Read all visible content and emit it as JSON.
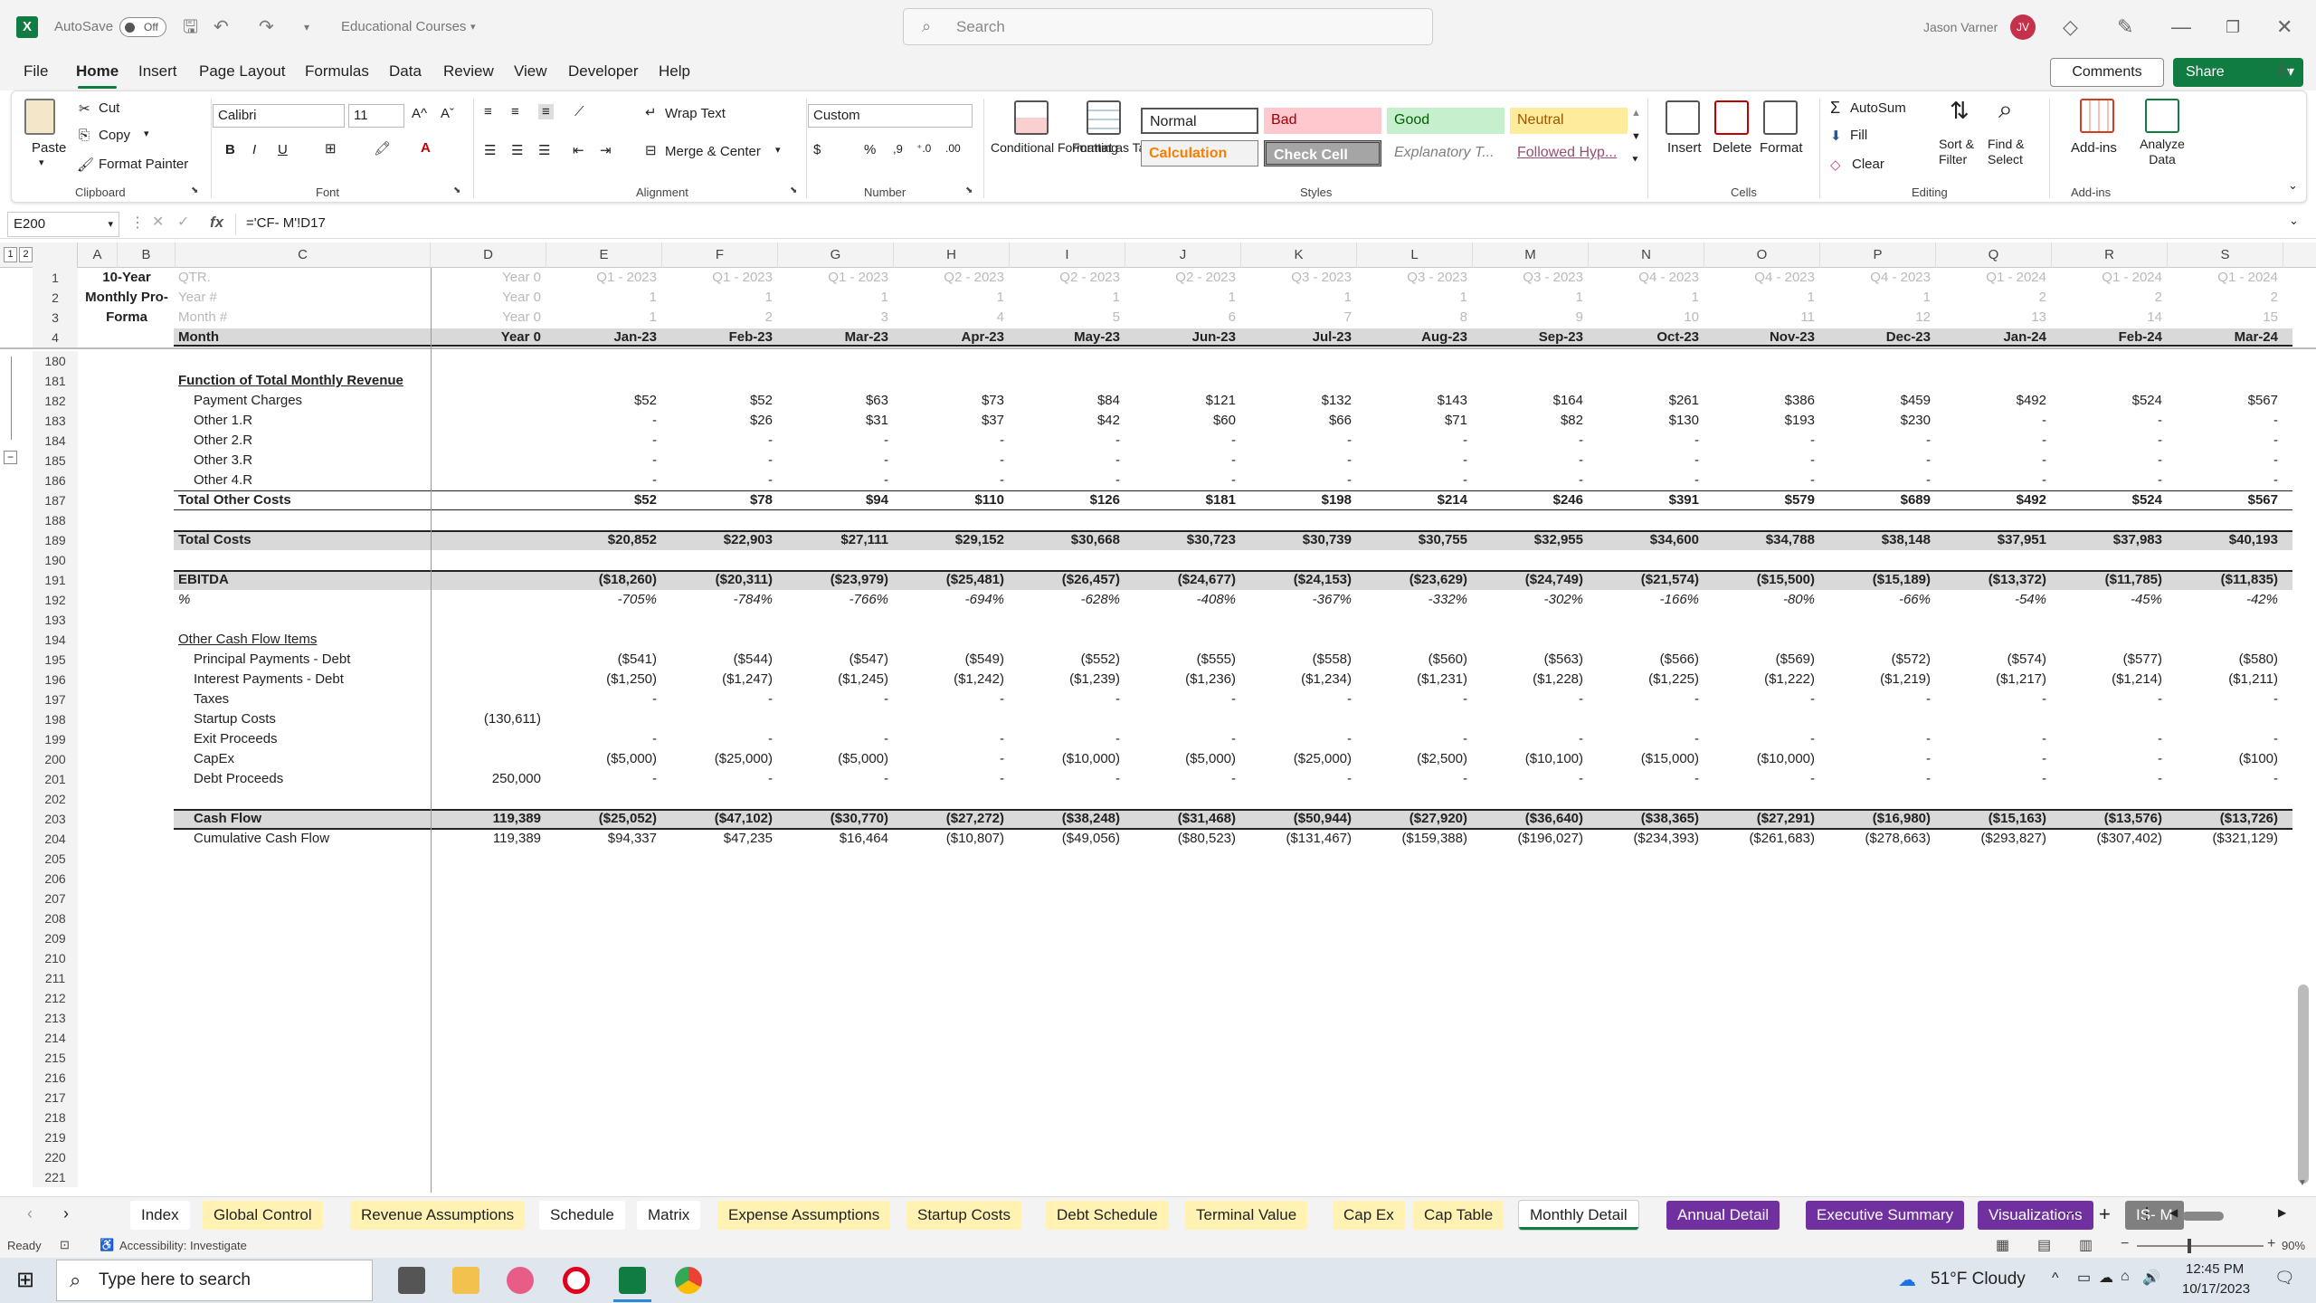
{
  "titlebar": {
    "autosave": "AutoSave",
    "toggle": "Off",
    "doc": "Educational Courses",
    "search_placeholder": "Search",
    "user": "Jason Varner",
    "initials": "JV"
  },
  "menu": [
    "File",
    "Home",
    "Insert",
    "Page Layout",
    "Formulas",
    "Data",
    "Review",
    "View",
    "Developer",
    "Help"
  ],
  "menu_active": "Home",
  "comments": "Comments",
  "share": "Share",
  "ribbon": {
    "paste": "Paste",
    "cut": "Cut",
    "copy": "Copy",
    "format_painter": "Format Painter",
    "clipboard": "Clipboard",
    "font_name": "Calibri",
    "font_size": "11",
    "font": "Font",
    "wrap_text": "Wrap Text",
    "merge_center": "Merge & Center",
    "alignment": "Alignment",
    "number_format": "Custom",
    "number": "Number",
    "conditional_formatting": "Conditional Formatting",
    "format_as_table": "Format as Table",
    "styles": {
      "normal": "Normal",
      "bad": "Bad",
      "good": "Good",
      "neutral": "Neutral",
      "calculation": "Calculation",
      "check_cell": "Check Cell",
      "explanatory": "Explanatory T...",
      "followed": "Followed Hyp..."
    },
    "styles_label": "Styles",
    "insert": "Insert",
    "delete": "Delete",
    "format": "Format",
    "cells": "Cells",
    "autosum": "AutoSum",
    "fill": "Fill",
    "clear": "Clear",
    "sort_filter": "Sort & Filter",
    "find_select": "Find & Select",
    "editing": "Editing",
    "addins": "Add-ins",
    "analyze": "Analyze Data",
    "addins_group": "Add-ins"
  },
  "formula_bar": {
    "name_box": "E200",
    "fx": "fx",
    "formula": "='CF- M'!D17"
  },
  "outline_levels": [
    "1",
    "2"
  ],
  "columns": [
    "A",
    "B",
    "C",
    "D",
    "E",
    "F",
    "G",
    "H",
    "I",
    "J",
    "K",
    "L",
    "M",
    "N",
    "O",
    "P",
    "Q",
    "R",
    "S"
  ],
  "header_rows": [
    {
      "n": "1",
      "a": "10-Year",
      "c": "QTR.",
      "d": "Year 0",
      "v": [
        "Q1 - 2023",
        "Q1 - 2023",
        "Q1 - 2023",
        "Q2 - 2023",
        "Q2 - 2023",
        "Q2 - 2023",
        "Q3 - 2023",
        "Q3 - 2023",
        "Q3 - 2023",
        "Q4 - 2023",
        "Q4 - 2023",
        "Q4 - 2023",
        "Q1 - 2024",
        "Q1 - 2024",
        "Q1 - 2024"
      ]
    },
    {
      "n": "2",
      "a": "Monthly Pro-",
      "c": "Year #",
      "d": "Year 0",
      "v": [
        "1",
        "1",
        "1",
        "1",
        "1",
        "1",
        "1",
        "1",
        "1",
        "1",
        "1",
        "1",
        "2",
        "2",
        "2"
      ]
    },
    {
      "n": "3",
      "a": "Forma",
      "c": "Month #",
      "d": "Year 0",
      "v": [
        "1",
        "2",
        "3",
        "4",
        "5",
        "6",
        "7",
        "8",
        "9",
        "10",
        "11",
        "12",
        "13",
        "14",
        "15"
      ]
    },
    {
      "n": "4",
      "c": "Month",
      "d": "Year 0",
      "v": [
        "Jan-23",
        "Feb-23",
        "Mar-23",
        "Apr-23",
        "May-23",
        "Jun-23",
        "Jul-23",
        "Aug-23",
        "Sep-23",
        "Oct-23",
        "Nov-23",
        "Dec-23",
        "Jan-24",
        "Feb-24",
        "Mar-24"
      ]
    }
  ],
  "rows": [
    {
      "n": "180"
    },
    {
      "n": "181",
      "c": "Function of Total Monthly Revenue",
      "style": "section"
    },
    {
      "n": "182",
      "c": "Payment Charges",
      "indent": true,
      "v": [
        "$52",
        "$52",
        "$63",
        "$73",
        "$84",
        "$121",
        "$132",
        "$143",
        "$164",
        "$261",
        "$386",
        "$459",
        "$492",
        "$524",
        "$567"
      ]
    },
    {
      "n": "183",
      "c": "Other 1.R",
      "indent": true,
      "v": [
        "-",
        "$26",
        "$31",
        "$37",
        "$42",
        "$60",
        "$66",
        "$71",
        "$82",
        "$130",
        "$193",
        "$230",
        "-",
        "-",
        "-"
      ]
    },
    {
      "n": "184",
      "c": "Other 2.R",
      "indent": true,
      "v": [
        "-",
        "-",
        "-",
        "-",
        "-",
        "-",
        "-",
        "-",
        "-",
        "-",
        "-",
        "-",
        "-",
        "-",
        "-"
      ]
    },
    {
      "n": "185",
      "c": "Other 3.R",
      "indent": true,
      "v": [
        "-",
        "-",
        "-",
        "-",
        "-",
        "-",
        "-",
        "-",
        "-",
        "-",
        "-",
        "-",
        "-",
        "-",
        "-"
      ]
    },
    {
      "n": "186",
      "c": "Other 4.R",
      "indent": true,
      "v": [
        "-",
        "-",
        "-",
        "-",
        "-",
        "-",
        "-",
        "-",
        "-",
        "-",
        "-",
        "-",
        "-",
        "-",
        "-"
      ]
    },
    {
      "n": "187",
      "c": "Total Other Costs",
      "style": "total",
      "v": [
        "$52",
        "$78",
        "$94",
        "$110",
        "$126",
        "$181",
        "$198",
        "$214",
        "$246",
        "$391",
        "$579",
        "$689",
        "$492",
        "$524",
        "$567"
      ]
    },
    {
      "n": "188"
    },
    {
      "n": "189",
      "c": "Total Costs",
      "style": "band",
      "v": [
        "$20,852",
        "$22,903",
        "$27,111",
        "$29,152",
        "$30,668",
        "$30,723",
        "$30,739",
        "$30,755",
        "$32,955",
        "$34,600",
        "$34,788",
        "$38,148",
        "$37,951",
        "$37,983",
        "$40,193"
      ]
    },
    {
      "n": "190"
    },
    {
      "n": "191",
      "c": "EBITDA",
      "style": "band",
      "v": [
        "($18,260)",
        "($20,311)",
        "($23,979)",
        "($25,481)",
        "($26,457)",
        "($24,677)",
        "($24,153)",
        "($23,629)",
        "($24,749)",
        "($21,574)",
        "($15,500)",
        "($15,189)",
        "($13,372)",
        "($11,785)",
        "($11,835)"
      ]
    },
    {
      "n": "192",
      "c": "%",
      "style": "pct",
      "v": [
        "-705%",
        "-784%",
        "-766%",
        "-694%",
        "-628%",
        "-408%",
        "-367%",
        "-332%",
        "-302%",
        "-166%",
        "-80%",
        "-66%",
        "-54%",
        "-45%",
        "-42%"
      ]
    },
    {
      "n": "193"
    },
    {
      "n": "194",
      "c": "Other Cash Flow Items",
      "style": "uline"
    },
    {
      "n": "195",
      "c": "Principal Payments - Debt",
      "indent": true,
      "v": [
        "($541)",
        "($544)",
        "($547)",
        "($549)",
        "($552)",
        "($555)",
        "($558)",
        "($560)",
        "($563)",
        "($566)",
        "($569)",
        "($572)",
        "($574)",
        "($577)",
        "($580)"
      ]
    },
    {
      "n": "196",
      "c": "Interest Payments - Debt",
      "indent": true,
      "v": [
        "($1,250)",
        "($1,247)",
        "($1,245)",
        "($1,242)",
        "($1,239)",
        "($1,236)",
        "($1,234)",
        "($1,231)",
        "($1,228)",
        "($1,225)",
        "($1,222)",
        "($1,219)",
        "($1,217)",
        "($1,214)",
        "($1,211)"
      ]
    },
    {
      "n": "197",
      "c": "Taxes",
      "indent": true,
      "v": [
        "-",
        "-",
        "-",
        "-",
        "-",
        "-",
        "-",
        "-",
        "-",
        "-",
        "-",
        "-",
        "-",
        "-",
        "-"
      ]
    },
    {
      "n": "198",
      "c": "Startup Costs",
      "indent": true,
      "d": "(130,611)"
    },
    {
      "n": "199",
      "c": "Exit Proceeds",
      "indent": true,
      "v": [
        "-",
        "-",
        "-",
        "-",
        "-",
        "-",
        "-",
        "-",
        "-",
        "-",
        "-",
        "-",
        "-",
        "-",
        "-"
      ]
    },
    {
      "n": "200",
      "c": "CapEx",
      "indent": true,
      "v": [
        "($5,000)",
        "($25,000)",
        "($5,000)",
        "-",
        "($10,000)",
        "($5,000)",
        "($25,000)",
        "($2,500)",
        "($10,100)",
        "($15,000)",
        "($10,000)",
        "-",
        "-",
        "-",
        "($100)"
      ]
    },
    {
      "n": "201",
      "c": "Debt Proceeds",
      "indent": true,
      "d": "250,000",
      "v": [
        "-",
        "-",
        "-",
        "-",
        "-",
        "-",
        "-",
        "-",
        "-",
        "-",
        "-",
        "-",
        "-",
        "-",
        "-"
      ]
    },
    {
      "n": "202"
    },
    {
      "n": "203",
      "c": "Cash Flow",
      "style": "cashflow",
      "d": "119,389",
      "v": [
        "($25,052)",
        "($47,102)",
        "($30,770)",
        "($27,272)",
        "($38,248)",
        "($31,468)",
        "($50,944)",
        "($27,920)",
        "($36,640)",
        "($38,365)",
        "($27,291)",
        "($16,980)",
        "($15,163)",
        "($13,576)",
        "($13,726)"
      ]
    },
    {
      "n": "204",
      "c": "Cumulative Cash Flow",
      "indent": true,
      "d": "119,389",
      "v": [
        "$94,337",
        "$47,235",
        "$16,464",
        "($10,807)",
        "($49,056)",
        "($80,523)",
        "($131,467)",
        "($159,388)",
        "($196,027)",
        "($234,393)",
        "($261,683)",
        "($278,663)",
        "($293,827)",
        "($307,402)",
        "($321,129)"
      ]
    },
    {
      "n": "205"
    },
    {
      "n": "206"
    },
    {
      "n": "207"
    },
    {
      "n": "208"
    },
    {
      "n": "209"
    },
    {
      "n": "210"
    },
    {
      "n": "211"
    },
    {
      "n": "212"
    },
    {
      "n": "213"
    },
    {
      "n": "214"
    },
    {
      "n": "215"
    },
    {
      "n": "216"
    },
    {
      "n": "217"
    },
    {
      "n": "218"
    },
    {
      "n": "219"
    },
    {
      "n": "220"
    },
    {
      "n": "221"
    }
  ],
  "sheet_tabs": [
    {
      "name": "Index",
      "color": "#ffffff",
      "text": "#222"
    },
    {
      "name": "Global Control",
      "color": "#fff2b3",
      "text": "#222"
    },
    {
      "name": "Revenue Assumptions",
      "color": "#fff2b3",
      "text": "#222"
    },
    {
      "name": "Schedule",
      "color": "#ffffff",
      "text": "#222"
    },
    {
      "name": "Matrix",
      "color": "#ffffff",
      "text": "#222"
    },
    {
      "name": "Expense Assumptions",
      "color": "#fff2b3",
      "text": "#222"
    },
    {
      "name": "Startup Costs",
      "color": "#fff2b3",
      "text": "#222"
    },
    {
      "name": "Debt Schedule",
      "color": "#fff2b3",
      "text": "#222"
    },
    {
      "name": "Terminal Value",
      "color": "#fff2b3",
      "text": "#222"
    },
    {
      "name": "Cap Ex",
      "color": "#fff2b3",
      "text": "#222"
    },
    {
      "name": "Cap Table",
      "color": "#fff2b3",
      "text": "#222"
    },
    {
      "name": "Monthly Detail",
      "color": "#ffffff",
      "text": "#222",
      "active": true
    },
    {
      "name": "Annual Detail",
      "color": "#7030a0",
      "text": "#ffffff"
    },
    {
      "name": "Executive Summary",
      "color": "#7030a0",
      "text": "#ffffff"
    },
    {
      "name": "Visualizations",
      "color": "#7030a0",
      "text": "#ffffff"
    },
    {
      "name": "IS- M",
      "color": "#808080",
      "text": "#ffffff"
    }
  ],
  "status": {
    "ready": "Ready",
    "accessibility": "Accessibility: Investigate",
    "zoom": "90%"
  },
  "taskbar": {
    "search": "Type here to search",
    "weather": "51°F Cloudy",
    "time": "12:45 PM",
    "date": "10/17/2023"
  },
  "colors": {
    "excel_green": "#107c41",
    "purple_tab": "#7030a0"
  }
}
